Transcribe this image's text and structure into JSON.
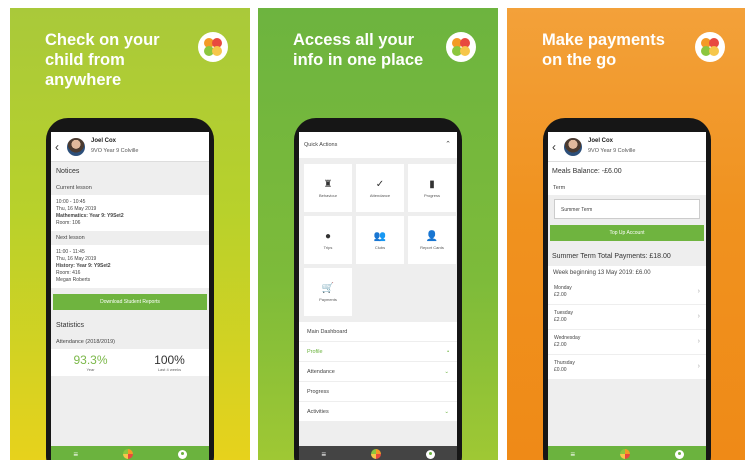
{
  "panel1": {
    "headline": "Check on your child from anywhere",
    "student_name": "Joel Cox",
    "student_class": "9VO  Year 9  Colville",
    "notices_title": "Notices",
    "current_lesson_title": "Current lesson",
    "current_lesson": {
      "time": "10:00 - 10:45",
      "date": "Thu, 16 May 2019",
      "subject": "Mathematics: Year 9: Y9Set2",
      "room": "Room: 106"
    },
    "next_lesson_title": "Next lesson",
    "next_lesson": {
      "time": "11:00 - 11:45",
      "date": "Thu, 16 May 2019",
      "subject": "History: Year 9: Y9Set2",
      "room": "Room: 416",
      "teacher": "Megan Roberts"
    },
    "download_button": "Download Student Reports",
    "statistics_title": "Statistics",
    "attendance_title": "Attendance (2018/2019)",
    "stat_year_value": "93.3%",
    "stat_year_label": "Year",
    "stat_recent_value": "100%",
    "stat_recent_label": "Last 4 weeks",
    "tabbar_menu": "≡"
  },
  "panel2": {
    "headline": "Access all your info in one place",
    "quick_actions_title": "Quick Actions",
    "quick_actions_chevron": "⌃",
    "tiles": [
      {
        "label": "Behaviour",
        "icon": "♜"
      },
      {
        "label": "Attendance",
        "icon": "✓"
      },
      {
        "label": "Progress",
        "icon": "▮"
      },
      {
        "label": "Trips",
        "icon": "●"
      },
      {
        "label": "Clubs",
        "icon": "👥"
      },
      {
        "label": "Report Cards",
        "icon": "👤"
      },
      {
        "label": "Payments",
        "icon": "🛒"
      }
    ],
    "menu": [
      {
        "label": "Main Dashboard",
        "right": ""
      },
      {
        "label": "Profile",
        "right": "•"
      },
      {
        "label": "Attendance",
        "right": "⌄"
      },
      {
        "label": "Progress",
        "right": ""
      },
      {
        "label": "Activities",
        "right": "⌄"
      }
    ],
    "tabbar_menu": "≡"
  },
  "panel3": {
    "headline": "Make payments on the go",
    "student_name": "Joel Cox",
    "student_class": "9VO  Year 9  Colville",
    "meals_balance": "Meals Balance: -£6.00",
    "term_label": "Term",
    "term_value": "Summer Term",
    "topup_button": "Top Up Account",
    "term_total": "Summer Term Total Payments: £18.00",
    "week_label": "Week beginning 13 May 2019: £6.00",
    "days": [
      {
        "day": "Monday",
        "amount": "£2.00"
      },
      {
        "day": "Tuesday",
        "amount": "£2.00"
      },
      {
        "day": "Wednesday",
        "amount": "£2.00"
      },
      {
        "day": "Thursday",
        "amount": "£0.00"
      }
    ],
    "tabbar_menu": "≡"
  },
  "colors": {
    "green": "#6bb33e",
    "orange": "#ef8a17",
    "lime": "#b8d12b"
  }
}
